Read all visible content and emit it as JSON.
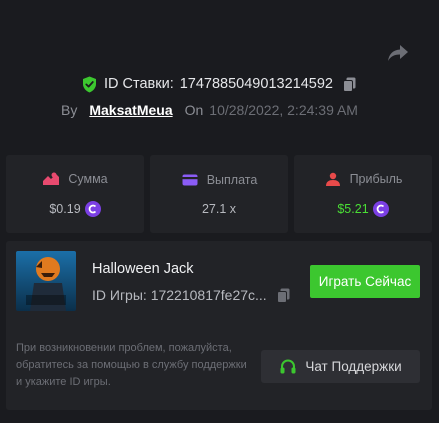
{
  "header": {
    "bet_id_label": "ID Ставки:",
    "bet_id": "1747885049013214592",
    "by_label": "By",
    "username": "MaksatMeua",
    "on_label": "On",
    "date": "10/28/2022, 2:24:39 AM"
  },
  "stats": [
    {
      "label": "Сумма",
      "value": "$0.19",
      "icon": "sum-icon",
      "icon_color": "#e84a6f"
    },
    {
      "label": "Выплата",
      "value": "27.1 x",
      "icon": "card-icon",
      "icon_color": "#8b5cf6"
    },
    {
      "label": "Прибыль",
      "value": "$5.21",
      "icon": "profit-icon",
      "icon_color": "#e84a4a"
    }
  ],
  "game": {
    "title": "Halloween Jack",
    "id_label": "ID Игры:",
    "id": "172210817fe27c...",
    "play_label": "Играть Сейчас",
    "thumb_text": "HALLOWEEN JACK"
  },
  "support": {
    "text": "При возникновении проблем, пожалуйста, обратитесь за помощью в службу поддержки и укажите ID игры.",
    "button_label": "Чат Поддержки"
  },
  "colors": {
    "background": "#1a1b1f",
    "card": "#222327",
    "accent_green": "#3cc72f",
    "profit_green": "#4ade35",
    "coin_purple": "#7b3fe4"
  }
}
